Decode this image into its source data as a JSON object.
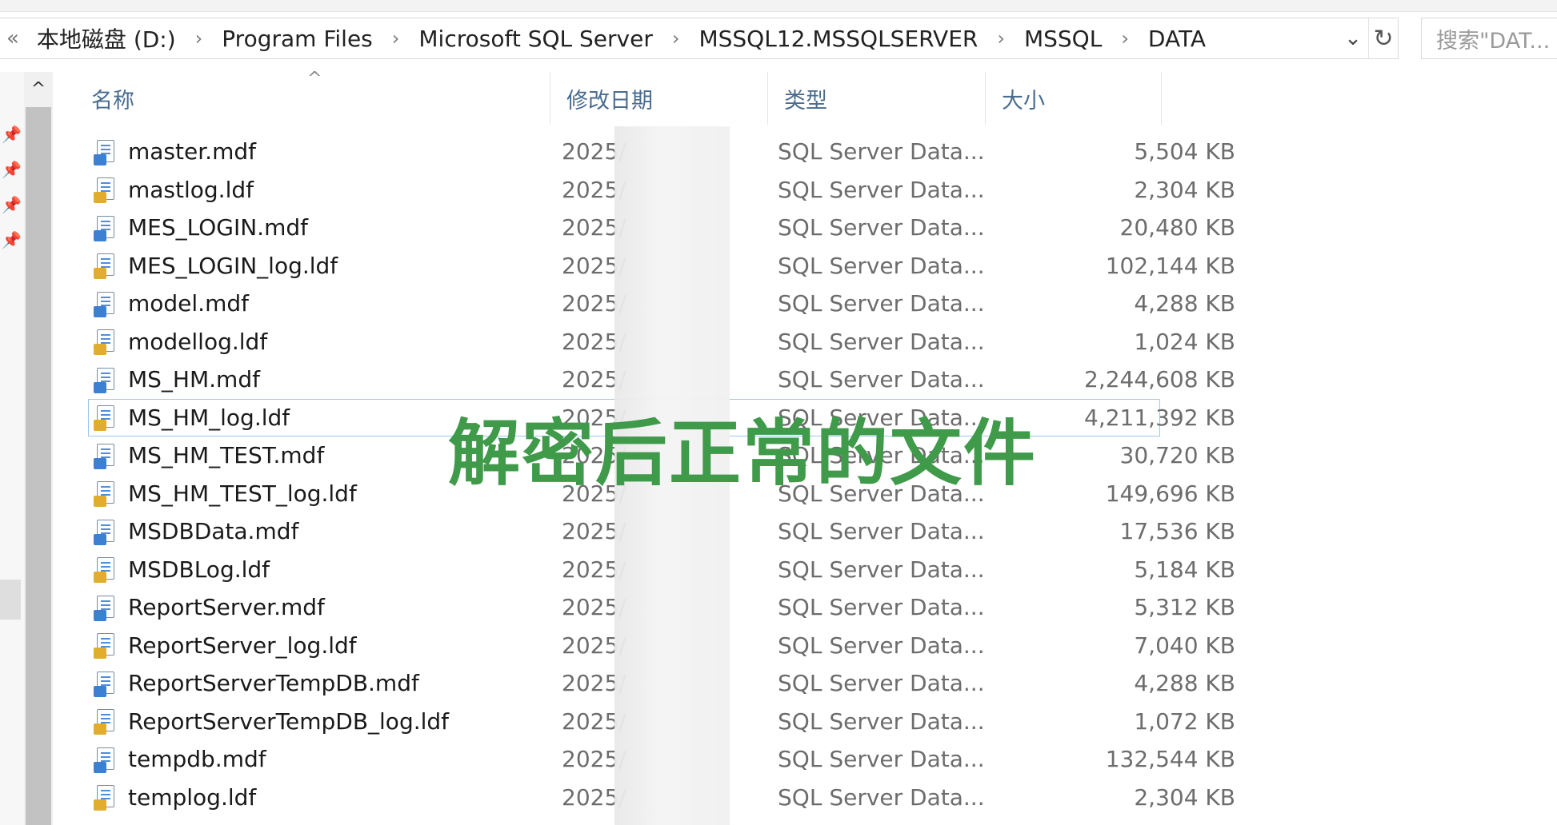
{
  "breadcrumb": {
    "overflow": "«",
    "items": [
      "本地磁盘 (D:)",
      "Program Files",
      "Microsoft SQL Server",
      "MSSQL12.MSSQLSERVER",
      "MSSQL",
      "DATA"
    ],
    "separator": "›"
  },
  "search": {
    "placeholder": "搜索\"DAT..."
  },
  "columns": {
    "name": "名称",
    "date": "修改日期",
    "type": "类型",
    "size": "大小"
  },
  "icons": {
    "mdf": "database-file-icon",
    "ldf": "log-file-icon",
    "pin": "pin-icon",
    "refresh": "refresh-icon",
    "dropdown": "chevron-down-icon"
  },
  "files": [
    {
      "name": "master.mdf",
      "date": "2025/",
      "type": "SQL Server Data...",
      "size": "5,504 KB",
      "kind": "mdf"
    },
    {
      "name": "mastlog.ldf",
      "date": "2025/",
      "type": "SQL Server Data...",
      "size": "2,304 KB",
      "kind": "ldf"
    },
    {
      "name": "MES_LOGIN.mdf",
      "date": "2025/",
      "type": "SQL Server Data...",
      "size": "20,480 KB",
      "kind": "mdf"
    },
    {
      "name": "MES_LOGIN_log.ldf",
      "date": "2025/",
      "type": "SQL Server Data...",
      "size": "102,144 KB",
      "kind": "ldf"
    },
    {
      "name": "model.mdf",
      "date": "2025/",
      "type": "SQL Server Data...",
      "size": "4,288 KB",
      "kind": "mdf"
    },
    {
      "name": "modellog.ldf",
      "date": "2025/",
      "type": "SQL Server Data...",
      "size": "1,024 KB",
      "kind": "ldf"
    },
    {
      "name": "MS_HM.mdf",
      "date": "2025/",
      "type": "SQL Server Data...",
      "size": "2,244,608 KB",
      "kind": "mdf"
    },
    {
      "name": "MS_HM_log.ldf",
      "date": "2025/",
      "type": "SQL Server Data...",
      "size": "4,211,392 KB",
      "kind": "ldf",
      "focused": true
    },
    {
      "name": "MS_HM_TEST.mdf",
      "date": "2025/",
      "type": "SQL Server Data...",
      "size": "30,720 KB",
      "kind": "mdf"
    },
    {
      "name": "MS_HM_TEST_log.ldf",
      "date": "2025/",
      "type": "SQL Server Data...",
      "size": "149,696 KB",
      "kind": "ldf"
    },
    {
      "name": "MSDBData.mdf",
      "date": "2025/",
      "type": "SQL Server Data...",
      "size": "17,536 KB",
      "kind": "mdf"
    },
    {
      "name": "MSDBLog.ldf",
      "date": "2025/",
      "type": "SQL Server Data...",
      "size": "5,184 KB",
      "kind": "ldf"
    },
    {
      "name": "ReportServer.mdf",
      "date": "2025/",
      "type": "SQL Server Data...",
      "size": "5,312 KB",
      "kind": "mdf"
    },
    {
      "name": "ReportServer_log.ldf",
      "date": "2025/",
      "type": "SQL Server Data...",
      "size": "7,040 KB",
      "kind": "ldf"
    },
    {
      "name": "ReportServerTempDB.mdf",
      "date": "2025/",
      "type": "SQL Server Data...",
      "size": "4,288 KB",
      "kind": "mdf"
    },
    {
      "name": "ReportServerTempDB_log.ldf",
      "date": "2025/",
      "type": "SQL Server Data...",
      "size": "1,072 KB",
      "kind": "ldf"
    },
    {
      "name": "tempdb.mdf",
      "date": "2025/",
      "type": "SQL Server Data...",
      "size": "132,544 KB",
      "kind": "mdf"
    },
    {
      "name": "templog.ldf",
      "date": "2025/",
      "type": "SQL Server Data...",
      "size": "2,304 KB",
      "kind": "ldf"
    }
  ],
  "overlay_text": "解密后正常的文件",
  "colors": {
    "overlay": "#3f9a4a",
    "header_text": "#4a6c8f",
    "focus_outline": "#99c9ef"
  }
}
